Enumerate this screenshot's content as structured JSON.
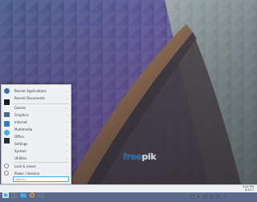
{
  "launcher": {
    "header_items": [
      {
        "label": "Recent Applications",
        "icon": "clock-icon"
      },
      {
        "label": "Recent Documents",
        "icon": "document-icon"
      }
    ],
    "categories": [
      {
        "label": "Games",
        "icon": "games-icon"
      },
      {
        "label": "Graphics",
        "icon": "graphics-icon"
      },
      {
        "label": "Internet",
        "icon": "internet-icon"
      },
      {
        "label": "Multimedia",
        "icon": "multimedia-icon"
      },
      {
        "label": "Office",
        "icon": "office-icon"
      },
      {
        "label": "Settings",
        "icon": "settings-icon"
      },
      {
        "label": "System",
        "icon": "system-icon"
      },
      {
        "label": "Utilities",
        "icon": "utilities-icon"
      }
    ],
    "footer_items": [
      {
        "label": "Lock & Leave"
      },
      {
        "label": "Power / Session"
      }
    ],
    "search_placeholder": "Search..."
  },
  "watermark": {
    "brand": "free",
    "rest": "pik"
  },
  "clock": {
    "time": "3:44 PM",
    "date": "5/1/17"
  },
  "colors": {
    "accent": "#3daee9",
    "panel": "#eff0f1"
  }
}
